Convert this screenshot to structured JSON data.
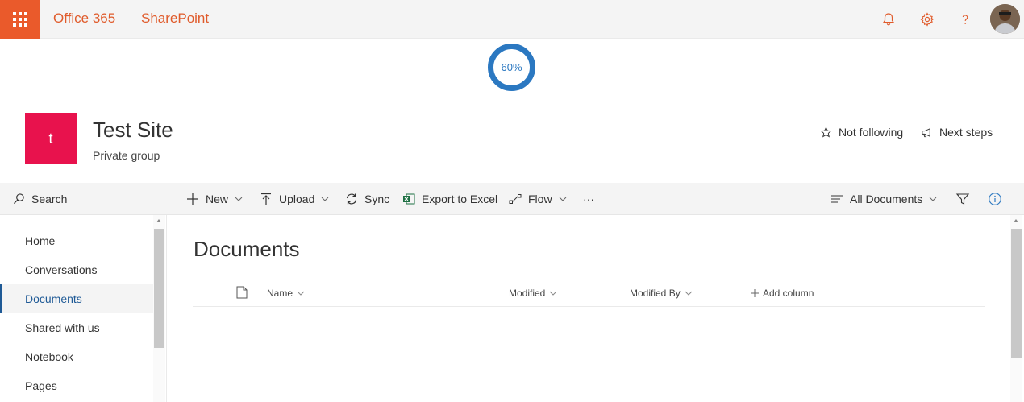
{
  "suite": {
    "app_name": "Office 365",
    "product": "SharePoint",
    "accent": "#ea5a2b",
    "icons": [
      "waffle-icon",
      "bell-icon",
      "gear-icon",
      "help-icon"
    ]
  },
  "progress": {
    "label": "60%",
    "value": 0.6,
    "color": "#2b78c1"
  },
  "site": {
    "logo_letter": "t",
    "logo_color": "#e8124d",
    "title": "Test Site",
    "subtitle": "Private group",
    "actions": {
      "follow": "Not following",
      "next_steps": "Next steps"
    }
  },
  "nav": {
    "search_label": "Search",
    "items": [
      {
        "label": "Home"
      },
      {
        "label": "Conversations"
      },
      {
        "label": "Documents",
        "active": true
      },
      {
        "label": "Shared with us"
      },
      {
        "label": "Notebook"
      },
      {
        "label": "Pages"
      }
    ]
  },
  "command_bar": {
    "new": "New",
    "upload": "Upload",
    "sync": "Sync",
    "export": "Export to Excel",
    "flow": "Flow",
    "more": "···",
    "view": "All Documents"
  },
  "library": {
    "title": "Documents",
    "columns": {
      "name": "Name",
      "modified": "Modified",
      "modified_by": "Modified By",
      "add": "Add column"
    }
  }
}
